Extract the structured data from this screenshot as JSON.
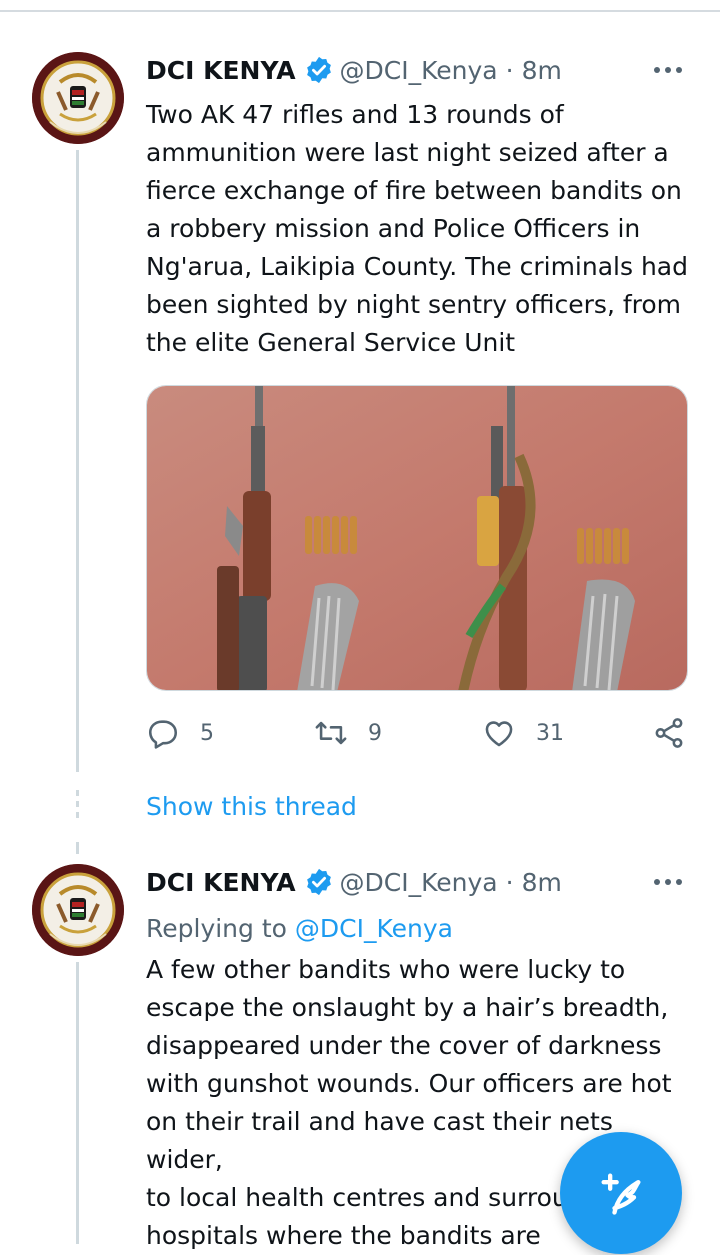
{
  "tweets": [
    {
      "name": "DCI KENYA",
      "handle": "@DCI_Kenya",
      "time": "8m",
      "text": "Two AK 47 rifles and 13 rounds of ammunition were last night seized after a fierce exchange of fire between bandits on a robbery mission and Police Officers in Ng'arua, Laikipia County. The criminals had been sighted by night sentry officers, from the elite General Service Unit",
      "text_lines": [
        "Two AK 47 rifles and 13 rounds of",
        "ammunition were last night seized after a",
        "fierce exchange of fire between bandits on",
        "a robbery mission and Police Officers in",
        "Ng'arua, Laikipia County. The criminals had",
        "been sighted by night sentry officers, from",
        "the elite General Service Unit"
      ],
      "replies": "5",
      "retweets": "9",
      "likes": "31"
    },
    {
      "name": "DCI KENYA",
      "handle": "@DCI_Kenya",
      "time": "8m",
      "replying_prefix": "Replying to",
      "replying_handle": "@DCI_Kenya",
      "text_lines": [
        "A few other bandits who were lucky to",
        "escape the onslaught by a hair’s breadth,",
        "disappeared under the cover of darkness",
        "with gunshot wounds. Our officers are hot",
        "on their trail and have cast their nets wider,",
        "to local health centres and surrour",
        "hospitals where the bandits are"
      ]
    }
  ],
  "show_thread": "Show this thread",
  "separator": "·",
  "colors": {
    "accent": "#1d9bf0",
    "secondary_text": "#536471",
    "text": "#0f1419"
  },
  "icons": [
    "verified-icon",
    "more-icon",
    "reply-icon",
    "retweet-icon",
    "like-icon",
    "share-icon",
    "compose-icon"
  ]
}
